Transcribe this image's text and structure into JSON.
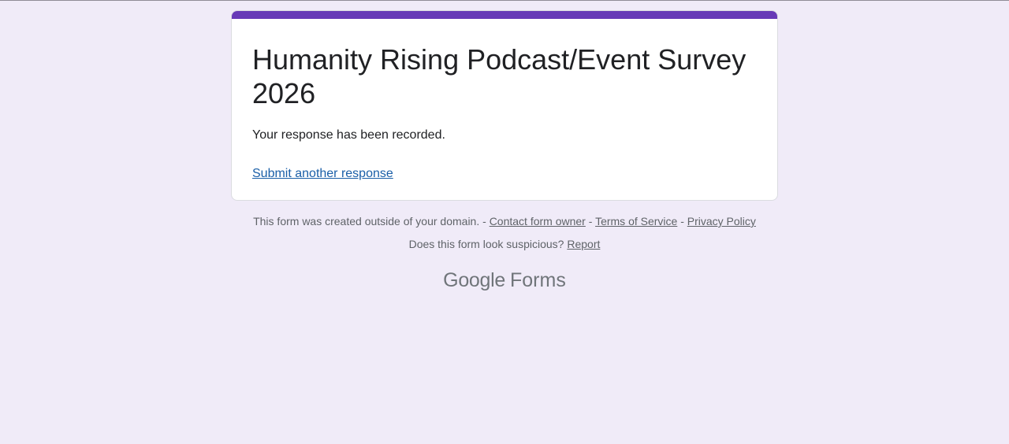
{
  "form": {
    "title": "Humanity Rising Podcast/Event Survey 2026",
    "confirmation": "Your response has been recorded.",
    "submit_another": "Submit another response",
    "accent_color": "#673ab7"
  },
  "footer": {
    "domain_notice": "This form was created outside of your domain.",
    "separator": "-",
    "contact_owner": "Contact form owner",
    "terms": "Terms of Service",
    "privacy": "Privacy Policy",
    "suspicious_question": "Does this form look suspicious?",
    "report": "Report"
  },
  "brand": {
    "google": "Google",
    "product": "Forms"
  },
  "colors": {
    "page_background": "#f0ebf8",
    "link": "#1a5fa8"
  }
}
